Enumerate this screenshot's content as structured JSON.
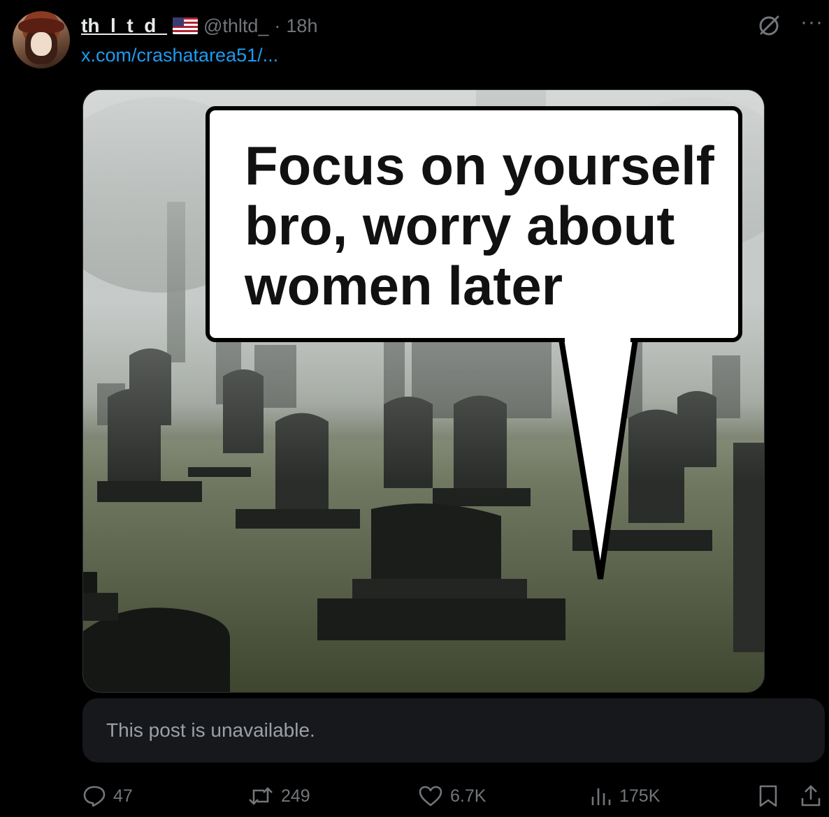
{
  "tweet": {
    "display_name": "th_l_t_d_",
    "handle": "@thltd_",
    "separator": "·",
    "time": "18h",
    "link": "x.com/crashatarea51/...",
    "more_label": "···"
  },
  "media": {
    "bubble_text": "Focus on yourself\nbro, worry about\nwomen later"
  },
  "quote": {
    "text": "This post is unavailable."
  },
  "actions": {
    "replies": "47",
    "reposts": "249",
    "likes": "6.7K",
    "views": "175K"
  },
  "colors": {
    "background": "#000000",
    "link": "#1d9bf0",
    "muted": "#71767b",
    "quote_bg": "#16181c"
  },
  "icons": [
    "grok-icon",
    "more-icon",
    "reply-icon",
    "repost-icon",
    "like-icon",
    "views-icon",
    "bookmark-icon",
    "share-icon"
  ]
}
